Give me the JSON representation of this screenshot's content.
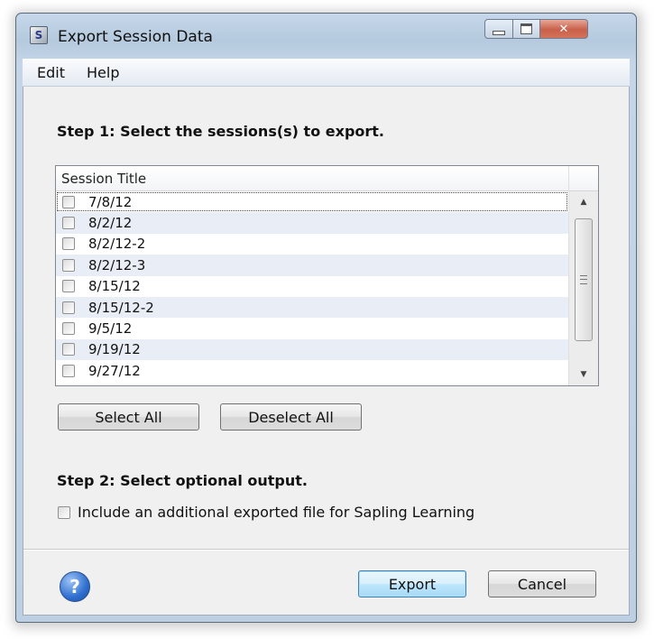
{
  "window": {
    "title": "Export Session Data",
    "controls": {
      "minimize": "minimize-icon",
      "maximize": "maximize-icon",
      "close": "✕"
    }
  },
  "menu": [
    {
      "label": "Edit"
    },
    {
      "label": "Help"
    }
  ],
  "step1": {
    "label": "Step 1: Select the sessions(s) to export.",
    "list": {
      "column_header": "Session Title",
      "rows": [
        "7/8/12",
        "8/2/12",
        "8/2/12-2",
        "8/2/12-3",
        "8/15/12",
        "8/15/12-2",
        "9/5/12",
        "9/19/12",
        "9/27/12"
      ],
      "checked": [
        false,
        false,
        false,
        false,
        false,
        false,
        false,
        false,
        false
      ]
    },
    "select_all": "Select All",
    "deselect_all": "Deselect All"
  },
  "step2": {
    "label": "Step 2: Select optional output.",
    "option_label": "Include an additional exported file for Sapling Learning",
    "option_checked": false
  },
  "footer": {
    "help_glyph": "?",
    "export": "Export",
    "cancel": "Cancel"
  },
  "colors": {
    "row_alt": "#e9eef6",
    "default_button_border": "#3c7fb1",
    "close_button": "#c9604a"
  }
}
